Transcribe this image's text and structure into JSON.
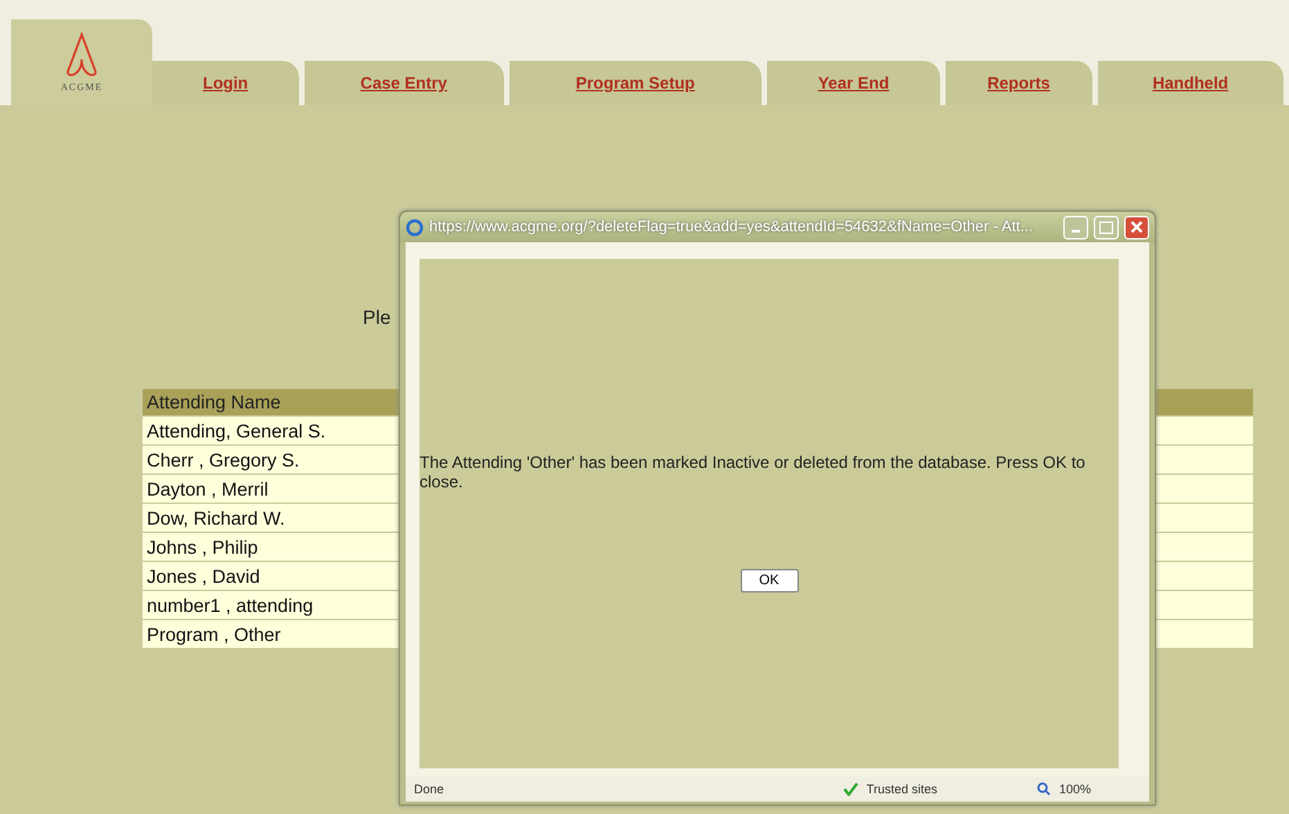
{
  "logo": {
    "text": "ACGME"
  },
  "nav": [
    {
      "label": "Login"
    },
    {
      "label": "Case Entry"
    },
    {
      "label": "Program Setup"
    },
    {
      "label": "Year End"
    },
    {
      "label": "Reports"
    },
    {
      "label": "Handheld"
    }
  ],
  "prompt": "Ple",
  "table": {
    "columns": [
      "Attending Name"
    ],
    "rows": [
      "Attending, General S.",
      "Cherr , Gregory S.",
      "Dayton , Merril",
      "Dow, Richard W.",
      "Johns , Philip",
      "Jones , David",
      "number1 , attending",
      "Program , Other"
    ]
  },
  "popup": {
    "title": "https://www.acgme.org/?deleteFlag=true&add=yes&attendId=54632&fName=Other - Att...",
    "message": "The Attending 'Other' has been marked Inactive or deleted from the database. Press OK to close.",
    "button": "OK",
    "status_bar": {
      "status": "Done",
      "zone": "Trusted sites",
      "zoom": "100%"
    }
  }
}
